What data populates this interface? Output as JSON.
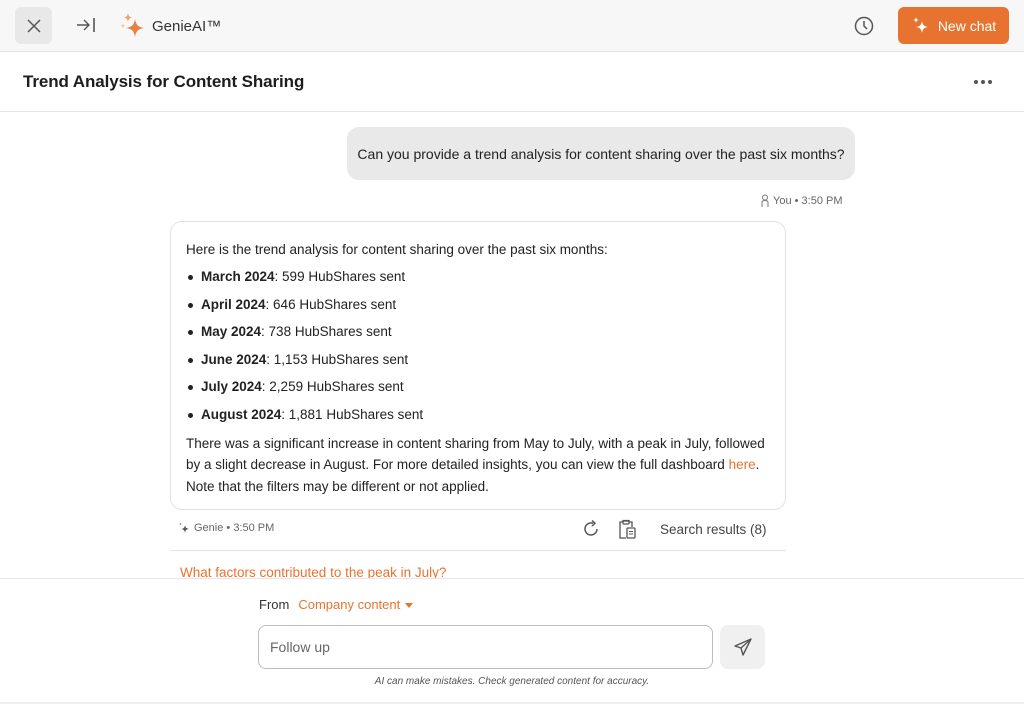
{
  "topbar": {
    "brand_name": "GenieAI™",
    "new_chat_label": "New chat",
    "icons": {
      "close": "close-icon",
      "collapse": "collapse-panel-icon",
      "brand": "sparkle-icon",
      "history": "clock-icon",
      "new_chat": "sparkle-icon"
    }
  },
  "conversation": {
    "title": "Trend Analysis for Content Sharing",
    "more_icon": "more-horizontal-icon"
  },
  "messages": {
    "user": {
      "text": "Can you provide a trend analysis for content sharing over the past six months?",
      "author": "You",
      "time": "3:50 PM",
      "meta": "You • 3:50 PM"
    },
    "bot": {
      "intro": "Here is the trend analysis for content sharing over the past six months:",
      "items": [
        {
          "label": "March 2024",
          "value": ": 599 HubShares sent"
        },
        {
          "label": "April 2024",
          "value": ": 646 HubShares sent"
        },
        {
          "label": "May 2024",
          "value": ": 738 HubShares sent"
        },
        {
          "label": "June 2024",
          "value": ": 1,153 HubShares sent"
        },
        {
          "label": "July 2024",
          "value": ": 2,259 HubShares sent"
        },
        {
          "label": "August 2024",
          "value": ": 1,881 HubShares sent"
        }
      ],
      "summary_before_link": "There was a significant increase in content sharing from May to July, with a peak in July, followed by a slight decrease in August. For more detailed insights, you can view the full dashboard ",
      "link_text": "here",
      "summary_after_link": ". Note that the filters may be different or not applied.",
      "author": "Genie",
      "time": "3:50 PM",
      "meta": "Genie • 3:50 PM",
      "search_results_label": "Search results (8)"
    },
    "suggestion": "What factors contributed to the peak in July?"
  },
  "composer": {
    "from_label": "From",
    "source_value": "Company content",
    "input_placeholder": "Follow up",
    "input_value": "",
    "disclaimer": "AI can make mistakes. Check generated content for accuracy."
  },
  "colors": {
    "accent": "#e87330",
    "bubble": "#e9e9e9",
    "topbar": "#f7f7f7"
  }
}
